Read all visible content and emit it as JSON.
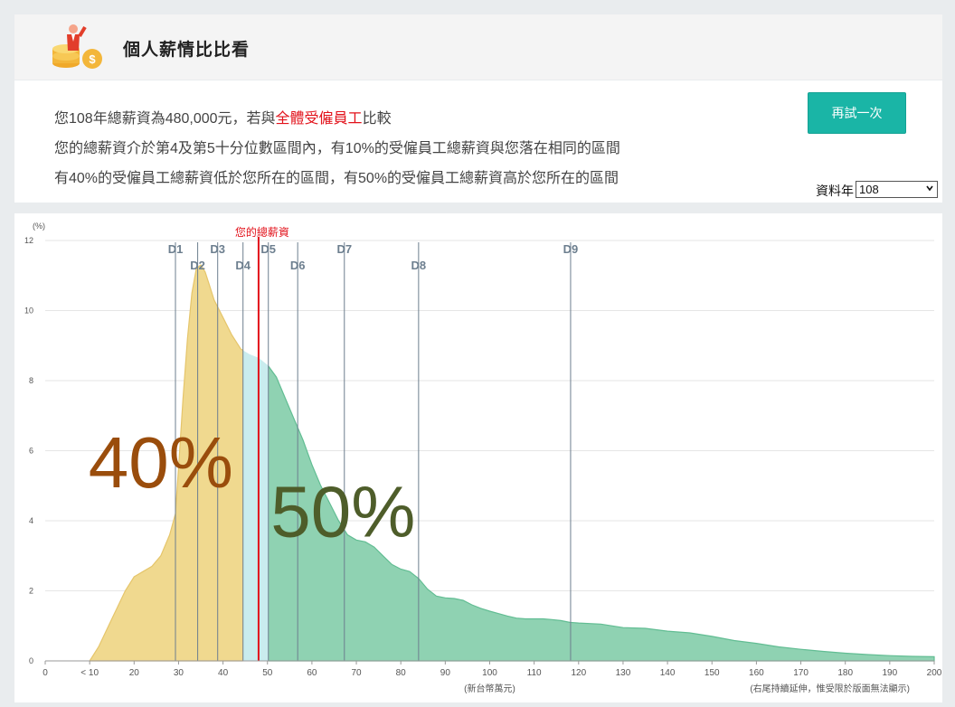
{
  "header": {
    "title": "個人薪情比比看"
  },
  "summary": {
    "line1_pre": "您108年總薪資為480,000元，若與",
    "line1_highlight": "全體受僱員工",
    "line1_post": "比較",
    "line2": "您的總薪資介於第4及第5十分位數區間內，有10%的受僱員工總薪資與您落在相同的區間",
    "line3": "有40%的受僱員工總薪資低於您所在的區間，有50%的受僱員工總薪資高於您所在的區間"
  },
  "controls": {
    "retry_label": "再試一次",
    "year_label": "資料年",
    "year_value": "108"
  },
  "colors": {
    "lower": "#f0d98f",
    "same": "#c9ecee",
    "higher": "#8fd2b2",
    "marker": "#e2111a",
    "decile_line": "#6d7f8f"
  },
  "chart_data": {
    "type": "area",
    "ylabel": "(%)",
    "xlabel": "(新台幣萬元)",
    "note": "(右尾持續延伸，惟受限於版面無法顯示)",
    "ylim": [
      0,
      12
    ],
    "yticks": [
      "0",
      "2",
      "4",
      "6",
      "8",
      "10",
      "12"
    ],
    "xlim": [
      0,
      200
    ],
    "xticks": [
      {
        "v": 0,
        "label": "0"
      },
      {
        "v": 10,
        "label": "< 10"
      },
      {
        "v": 20,
        "label": "20"
      },
      {
        "v": 30,
        "label": "30"
      },
      {
        "v": 40,
        "label": "40"
      },
      {
        "v": 50,
        "label": "50"
      },
      {
        "v": 60,
        "label": "60"
      },
      {
        "v": 70,
        "label": "70"
      },
      {
        "v": 80,
        "label": "80"
      },
      {
        "v": 90,
        "label": "90"
      },
      {
        "v": 100,
        "label": "100"
      },
      {
        "v": 110,
        "label": "110"
      },
      {
        "v": 120,
        "label": "120"
      },
      {
        "v": 130,
        "label": "130"
      },
      {
        "v": 140,
        "label": "140"
      },
      {
        "v": 150,
        "label": "150"
      },
      {
        "v": 160,
        "label": "160"
      },
      {
        "v": 170,
        "label": "170"
      },
      {
        "v": 180,
        "label": "180"
      },
      {
        "v": 190,
        "label": "190"
      },
      {
        "v": 200,
        "label": "200"
      }
    ],
    "curve": [
      [
        10,
        0
      ],
      [
        12,
        0.4
      ],
      [
        15,
        1.2
      ],
      [
        18,
        2.0
      ],
      [
        20,
        2.4
      ],
      [
        22,
        2.55
      ],
      [
        24,
        2.7
      ],
      [
        26,
        3.0
      ],
      [
        28,
        3.6
      ],
      [
        29.3,
        4.2
      ],
      [
        30,
        5.5
      ],
      [
        31,
        7.5
      ],
      [
        32,
        9.2
      ],
      [
        33,
        10.5
      ],
      [
        34,
        11.2
      ],
      [
        35,
        11.3
      ],
      [
        36,
        11.1
      ],
      [
        37,
        10.7
      ],
      [
        38,
        10.3
      ],
      [
        40,
        9.8
      ],
      [
        42,
        9.3
      ],
      [
        44,
        8.9
      ],
      [
        46,
        8.75
      ],
      [
        48,
        8.65
      ],
      [
        50,
        8.45
      ],
      [
        52,
        8.1
      ],
      [
        54,
        7.5
      ],
      [
        56,
        6.9
      ],
      [
        58,
        6.3
      ],
      [
        60,
        5.6
      ],
      [
        62,
        5.0
      ],
      [
        64,
        4.5
      ],
      [
        66,
        4.0
      ],
      [
        68,
        3.6
      ],
      [
        70,
        3.45
      ],
      [
        72,
        3.4
      ],
      [
        74,
        3.25
      ],
      [
        76,
        3.0
      ],
      [
        78,
        2.75
      ],
      [
        80,
        2.62
      ],
      [
        82,
        2.55
      ],
      [
        84,
        2.35
      ],
      [
        86,
        2.05
      ],
      [
        88,
        1.85
      ],
      [
        90,
        1.8
      ],
      [
        92,
        1.78
      ],
      [
        94,
        1.73
      ],
      [
        96,
        1.6
      ],
      [
        98,
        1.5
      ],
      [
        100,
        1.42
      ],
      [
        102,
        1.35
      ],
      [
        104,
        1.28
      ],
      [
        106,
        1.22
      ],
      [
        108,
        1.2
      ],
      [
        110,
        1.2
      ],
      [
        112,
        1.2
      ],
      [
        114,
        1.18
      ],
      [
        116,
        1.15
      ],
      [
        118,
        1.1
      ],
      [
        120,
        1.08
      ],
      [
        125,
        1.05
      ],
      [
        130,
        0.95
      ],
      [
        135,
        0.93
      ],
      [
        140,
        0.85
      ],
      [
        145,
        0.8
      ],
      [
        150,
        0.7
      ],
      [
        155,
        0.58
      ],
      [
        160,
        0.5
      ],
      [
        165,
        0.4
      ],
      [
        170,
        0.33
      ],
      [
        175,
        0.27
      ],
      [
        180,
        0.22
      ],
      [
        185,
        0.18
      ],
      [
        190,
        0.15
      ],
      [
        195,
        0.13
      ],
      [
        200,
        0.12
      ]
    ],
    "deciles": [
      {
        "name": "D1",
        "x": 29.3,
        "row": 1
      },
      {
        "name": "D2",
        "x": 34.3,
        "row": 2
      },
      {
        "name": "D3",
        "x": 38.8,
        "row": 1
      },
      {
        "name": "D4",
        "x": 44.5,
        "row": 2
      },
      {
        "name": "D5",
        "x": 50.2,
        "row": 1
      },
      {
        "name": "D6",
        "x": 56.8,
        "row": 2
      },
      {
        "name": "D7",
        "x": 67.3,
        "row": 1
      },
      {
        "name": "D8",
        "x": 84.0,
        "row": 2
      },
      {
        "name": "D9",
        "x": 118.2,
        "row": 1
      }
    ],
    "marker": {
      "label": "您的總薪資",
      "x": 48
    },
    "bands": {
      "lower_end": 44.5,
      "same_end": 50.2
    },
    "annotations": {
      "lower": "40%",
      "higher": "50%"
    }
  }
}
